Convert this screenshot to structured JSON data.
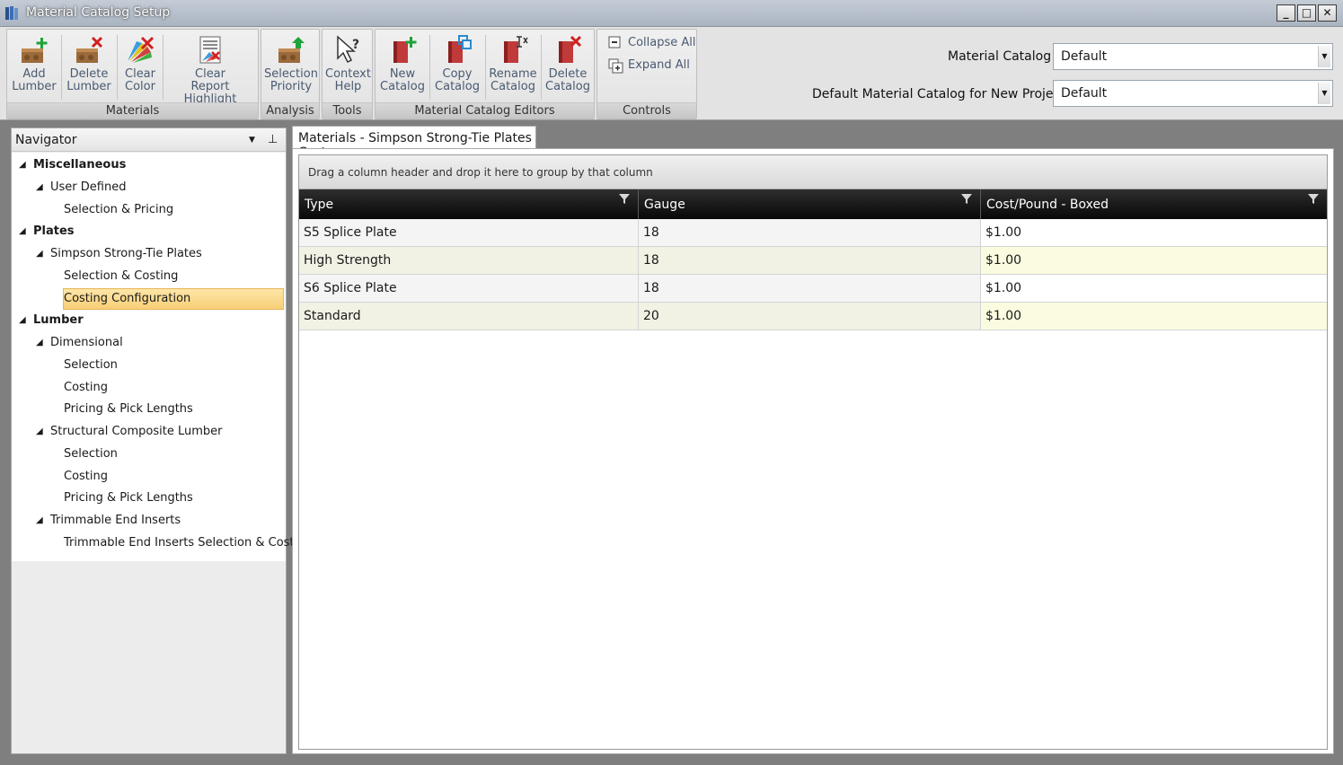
{
  "window": {
    "title": "Material Catalog Setup",
    "minimize": "_",
    "maximize": "□",
    "close": "✕"
  },
  "ribbon": {
    "groups": {
      "materials": "Materials",
      "analysis": "Analysis",
      "tools": "Tools",
      "editors": "Material Catalog Editors",
      "controls": "Controls"
    },
    "buttons": {
      "add_lumber": [
        "Add",
        "Lumber"
      ],
      "delete_lumber": [
        "Delete",
        "Lumber"
      ],
      "clear_color": [
        "Clear",
        "Color"
      ],
      "clear_report_highlight": [
        "Clear",
        "Report Highlight"
      ],
      "selection_priority": [
        "Selection",
        "Priority"
      ],
      "context_help": [
        "Context",
        "Help"
      ],
      "new_catalog": [
        "New",
        "Catalog"
      ],
      "copy_catalog": [
        "Copy",
        "Catalog"
      ],
      "rename_catalog": [
        "Rename",
        "Catalog"
      ],
      "delete_catalog": [
        "Delete",
        "Catalog"
      ],
      "collapse_all": "Collapse All",
      "expand_all": "Expand All"
    },
    "material_catalog_label": "Material Catalog",
    "material_catalog_value": "Default",
    "default_catalog_label": "Default Material Catalog for New Projects",
    "default_catalog_value": "Default",
    "dropdown_arrow": "▼"
  },
  "navigator": {
    "title": "Navigator",
    "drop_glyph": "▼",
    "pin_glyph": "⊥",
    "expand_glyph": "◢",
    "items": [
      {
        "label": "Miscellaneous",
        "level": 0,
        "expandable": true,
        "bold": true
      },
      {
        "label": "User Defined",
        "level": 1,
        "expandable": true
      },
      {
        "label": "Selection & Pricing",
        "level": 2
      },
      {
        "label": "Plates",
        "level": 0,
        "expandable": true,
        "bold": true
      },
      {
        "label": "Simpson Strong-Tie Plates",
        "level": 1,
        "expandable": true
      },
      {
        "label": "Selection & Costing",
        "level": 2
      },
      {
        "label": "Costing Configuration",
        "level": 2,
        "selected": true
      },
      {
        "label": "Lumber",
        "level": 0,
        "expandable": true,
        "bold": true
      },
      {
        "label": "Dimensional",
        "level": 1,
        "expandable": true
      },
      {
        "label": "Selection",
        "level": 2
      },
      {
        "label": "Costing",
        "level": 2
      },
      {
        "label": "Pricing & Pick Lengths",
        "level": 2
      },
      {
        "label": "Structural Composite Lumber",
        "level": 1,
        "expandable": true
      },
      {
        "label": "Selection",
        "level": 2
      },
      {
        "label": "Costing",
        "level": 2
      },
      {
        "label": "Pricing & Pick Lengths",
        "level": 2
      },
      {
        "label": "Trimmable End Inserts",
        "level": 1,
        "expandable": true
      },
      {
        "label": "Trimmable End Inserts Selection & Costing",
        "level": 2
      }
    ]
  },
  "content": {
    "tab_title": "Materials - Simpson Strong-Tie Plates Cost",
    "group_panel_text": "Drag a column header and drop it here to group by that column",
    "columns": [
      "Type",
      "Gauge",
      "Cost/Pound - Boxed"
    ],
    "rows": [
      [
        "S5 Splice Plate",
        "18",
        "$1.00"
      ],
      [
        "High Strength",
        "18",
        "$1.00"
      ],
      [
        "S6 Splice Plate",
        "18",
        "$1.00"
      ],
      [
        "Standard",
        "20",
        "$1.00"
      ]
    ]
  }
}
